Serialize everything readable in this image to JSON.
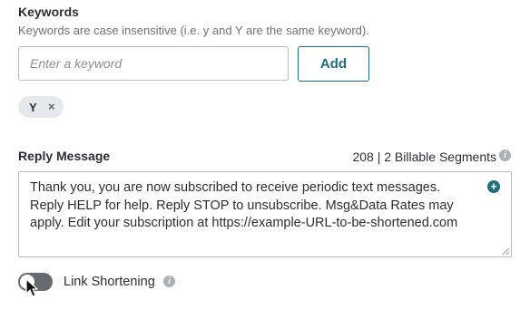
{
  "keywords": {
    "title": "Keywords",
    "subtitle": "Keywords are case insensitive (i.e. y and Y are the same keyword).",
    "input_placeholder": "Enter a keyword",
    "input_value": "",
    "add_label": "Add",
    "chips": [
      {
        "label": "Y",
        "remove_symbol": "×"
      }
    ]
  },
  "reply": {
    "title": "Reply Message",
    "count_text": "208 | 2 Billable Segments",
    "message": "Thank you, you are now subscribed to receive periodic text messages. Reply HELP for help. Reply STOP to unsubscribe. Msg&Data Rates may apply. Edit your subscription at https://example-URL-to-be-shortened.com",
    "add_symbol": "+"
  },
  "link_shortening": {
    "label": "Link Shortening",
    "enabled": false
  },
  "icons": {
    "info": "info-icon",
    "add": "plus-circle-icon",
    "remove": "close-icon",
    "cursor": "pointer-cursor-icon"
  },
  "colors": {
    "accent": "#1f6e7e",
    "toggle_off": "#646b71",
    "chip_bg": "#e6e9ec",
    "info_icon": "#a9b0b6"
  }
}
